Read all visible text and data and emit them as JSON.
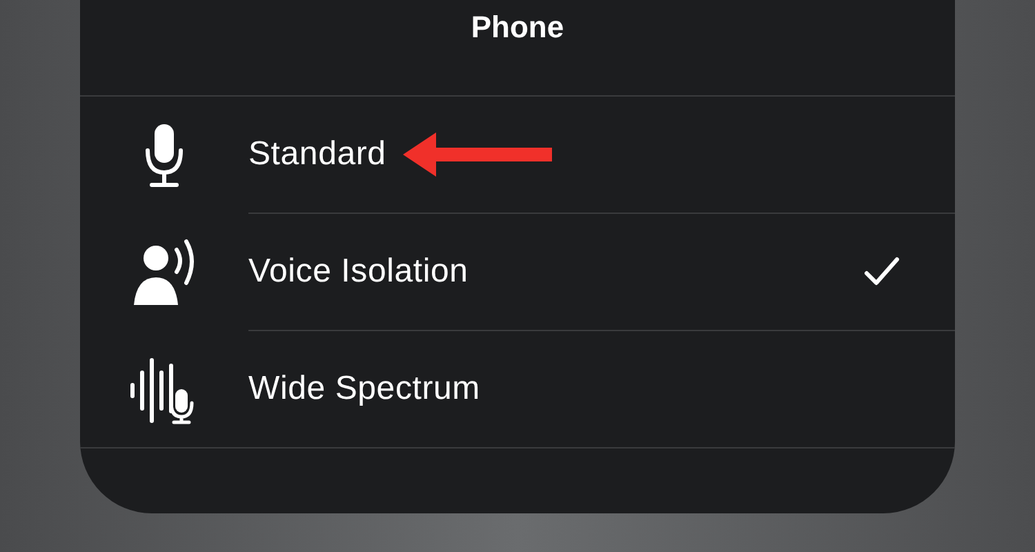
{
  "title": "Phone",
  "modes": [
    {
      "kind": "microphone",
      "label": "Standard",
      "selected": false,
      "arrow": true
    },
    {
      "kind": "voice",
      "label": "Voice Isolation",
      "selected": true,
      "arrow": false
    },
    {
      "kind": "spectrum",
      "label": "Wide Spectrum",
      "selected": false,
      "arrow": false
    }
  ]
}
